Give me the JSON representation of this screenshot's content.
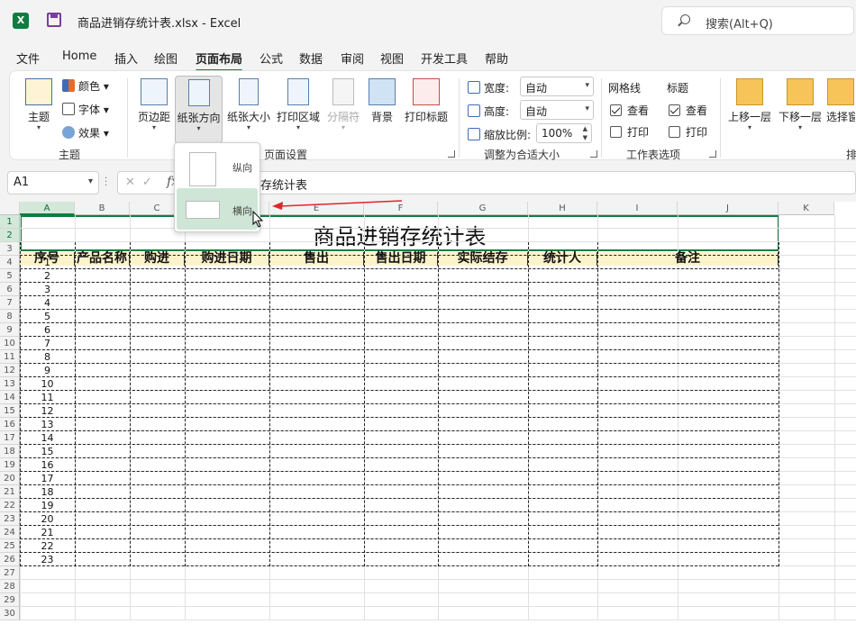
{
  "titlebar": {
    "app_icon_letter": "X",
    "doc_title": "商品进销存统计表.xlsx  -  Excel",
    "search_placeholder": "搜索(Alt+Q)"
  },
  "menu": {
    "tabs": [
      "文件",
      "Home",
      "插入",
      "绘图",
      "页面布局",
      "公式",
      "数据",
      "审阅",
      "视图",
      "开发工具",
      "帮助"
    ],
    "active_index": 4
  },
  "ribbon": {
    "theme_group": {
      "theme_label": "主题",
      "colors_label": "颜色",
      "fonts_label": "字体",
      "effects_label": "效果",
      "group_label": "主题"
    },
    "page_setup_group": {
      "margins": "页边距",
      "orientation": "纸张方向",
      "size": "纸张大小",
      "print_area": "打印区域",
      "breaks": "分隔符",
      "background": "背景",
      "print_titles": "打印标题",
      "group_label": "页面设置"
    },
    "scale_group": {
      "width_label": "宽度:",
      "width_value": "自动",
      "height_label": "高度:",
      "height_value": "自动",
      "scale_label": "缩放比例:",
      "scale_value": "100%",
      "group_label": "调整为合适大小"
    },
    "sheet_options_group": {
      "gridlines_label": "网格线",
      "headings_label": "标题",
      "view_label": "查看",
      "print_label": "打印",
      "group_label": "工作表选项"
    },
    "arrange_group": {
      "bring_forward": "上移一层",
      "send_backward": "下移一层",
      "selection_pane": "选择窗",
      "group_label_partial": "排"
    }
  },
  "formula_bar": {
    "name_box": "A1",
    "fx": "fx",
    "content": "存统计表"
  },
  "orientation_dropdown": {
    "portrait": "纵向",
    "landscape": "横向"
  },
  "sheet": {
    "columns": [
      "A",
      "B",
      "C",
      "D",
      "E",
      "F",
      "G",
      "H",
      "I",
      "J",
      "K"
    ],
    "rows": [
      "1",
      "2",
      "3",
      "4",
      "5",
      "6",
      "7",
      "8",
      "9",
      "10",
      "11",
      "12",
      "13",
      "14",
      "15",
      "16",
      "17",
      "18",
      "19",
      "20",
      "21",
      "22",
      "23",
      "24",
      "25",
      "26",
      "27",
      "28",
      "29",
      "30"
    ],
    "table_title": "商品进销存统计表",
    "table_headers": [
      "序号",
      "产品名称",
      "购进",
      "购进日期",
      "售出",
      "售出日期",
      "实际结存",
      "统计人",
      "备注"
    ],
    "sequence": [
      "1",
      "2",
      "3",
      "4",
      "5",
      "6",
      "7",
      "8",
      "9",
      "10",
      "11",
      "12",
      "13",
      "14",
      "15",
      "16",
      "17",
      "18",
      "19",
      "20",
      "21",
      "22",
      "23"
    ]
  },
  "colors": {
    "excel_green": "#107c41",
    "header_fill": "#fdf3cb",
    "hover_fill": "#cfe6d7",
    "arrow_red": "#e0262c"
  }
}
